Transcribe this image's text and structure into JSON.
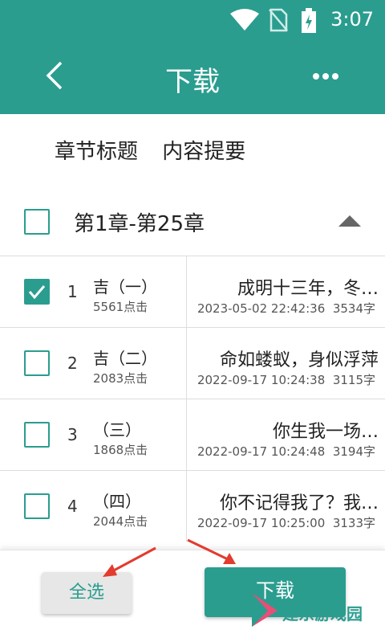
{
  "status": {
    "time": "3:07"
  },
  "appbar": {
    "title": "下载"
  },
  "tabs": [
    "章节标题",
    "内容提要"
  ],
  "group": {
    "title": "第1章-第25章"
  },
  "chapters": [
    {
      "index": "1",
      "title_partial": "吉（一）",
      "clicks": "5561点击",
      "summary": "成明十三年，冬…",
      "datetime": "2023-05-02 22:42:36",
      "words": "3534字",
      "checked": true
    },
    {
      "index": "2",
      "title_partial": "吉（二）",
      "clicks": "2083点击",
      "summary": "命如蝼蚁，身似浮萍",
      "datetime": "2022-09-17 10:24:38",
      "words": "3115字",
      "checked": false
    },
    {
      "index": "3",
      "title_partial": "（三）",
      "clicks": "1868点击",
      "summary": "你生我一场…",
      "datetime": "2022-09-17 10:24:48",
      "words": "3194字",
      "checked": false
    },
    {
      "index": "4",
      "title_partial": "（四）",
      "clicks": "2044点击",
      "summary": "你不记得我了？我…",
      "datetime": "2022-09-17 10:25:00",
      "words": "3133字",
      "checked": false
    }
  ],
  "buttons": {
    "select_all": "全选",
    "download": "下载"
  },
  "watermark": {
    "text": "建东游戏园"
  },
  "colors": {
    "primary": "#2a9d8f",
    "annotation_arrow": "#e23c2e"
  },
  "icons": [
    "back-icon",
    "more-icon",
    "wifi-icon",
    "no-sim-icon",
    "battery-icon",
    "collapse-icon",
    "checkmark-icon"
  ]
}
